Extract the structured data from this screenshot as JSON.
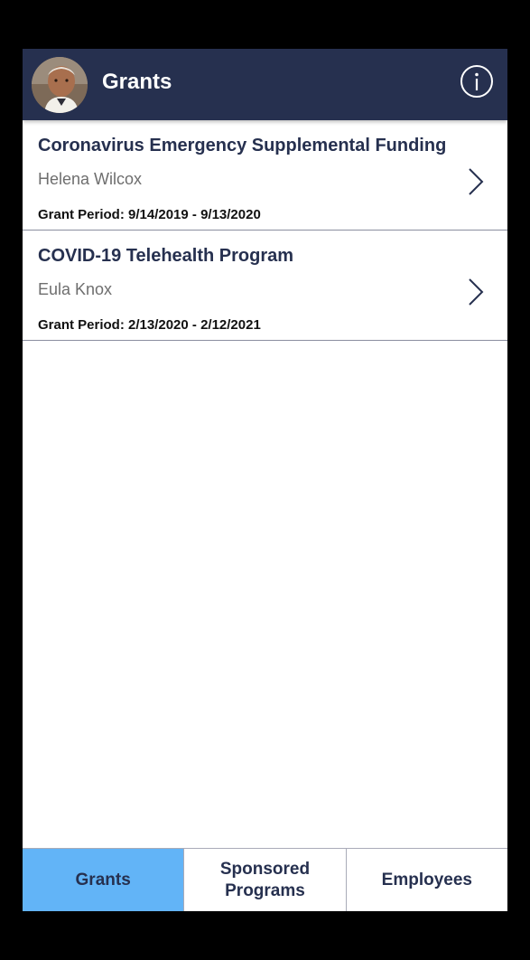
{
  "header": {
    "title": "Grants",
    "avatar_icon": "user-avatar",
    "info_icon": "info-icon"
  },
  "grants": [
    {
      "title": "Coronavirus Emergency Supplemental Funding",
      "person": "Helena Wilcox",
      "period": "Grant Period: 9/14/2019 - 9/13/2020"
    },
    {
      "title": "COVID-19 Telehealth Program",
      "person": "Eula Knox",
      "period": "Grant Period: 2/13/2020 - 2/12/2021"
    }
  ],
  "tabs": [
    {
      "label": "Grants",
      "active": true
    },
    {
      "label": "Sponsored Programs",
      "active": false
    },
    {
      "label": "Employees",
      "active": false
    }
  ],
  "colors": {
    "header_bg": "#26304f",
    "active_tab": "#62b4f7",
    "title_text": "#26304f"
  }
}
